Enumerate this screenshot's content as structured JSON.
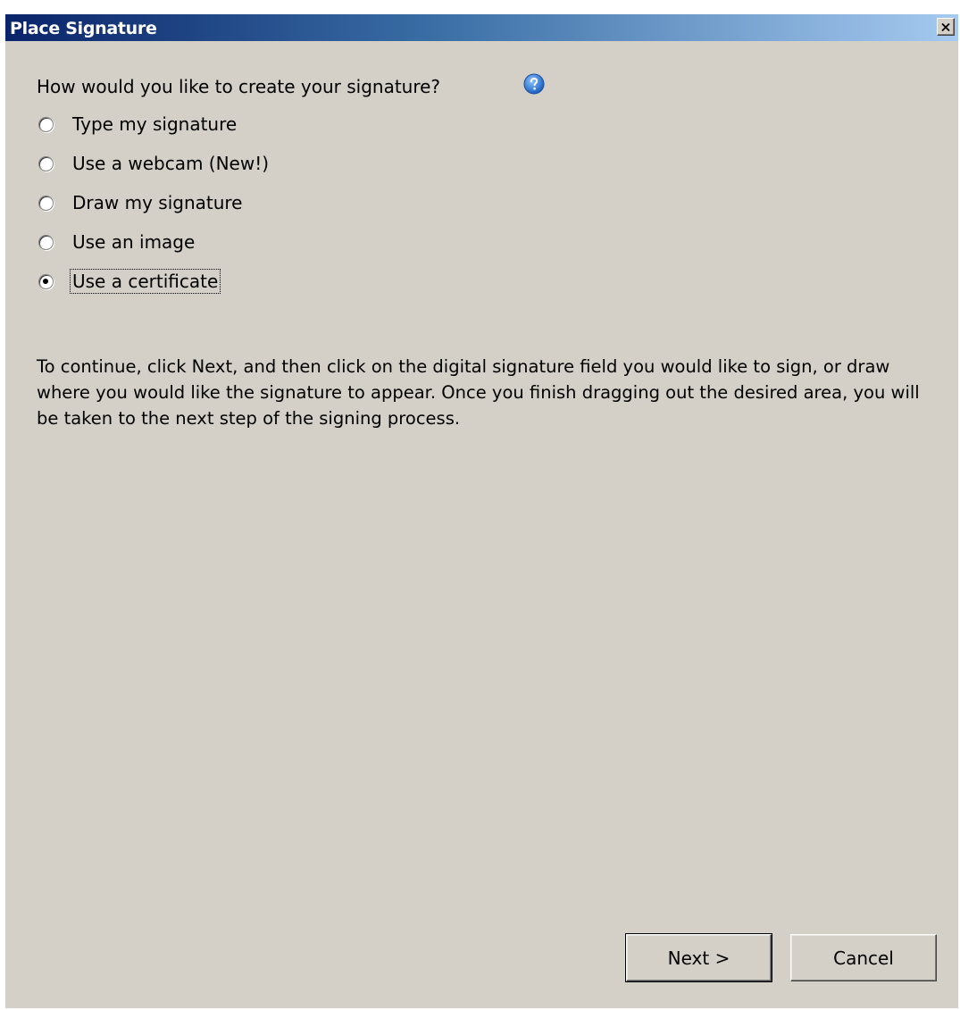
{
  "window": {
    "title": "Place Signature",
    "close_icon": "close-icon"
  },
  "prompt": {
    "question": "How would you like to create your signature?",
    "help_icon": "help-icon"
  },
  "options": [
    {
      "label": "Type my signature",
      "selected": false
    },
    {
      "label": "Use a webcam (New!)",
      "selected": false
    },
    {
      "label": "Draw my signature",
      "selected": false
    },
    {
      "label": "Use an image",
      "selected": false
    },
    {
      "label": "Use a certificate",
      "selected": true
    }
  ],
  "instructions": "To continue, click Next, and then click on the digital signature field you would like to sign, or draw where you would like the signature to appear. Once you finish dragging out the desired area, you will be taken to the next step of the signing process.",
  "buttons": {
    "next_label": "Next >",
    "cancel_label": "Cancel"
  },
  "colors": {
    "dialog_background": "#d4d0c8",
    "titlebar_start": "#0a246a",
    "titlebar_end": "#a6caf0",
    "help_icon_blue": "#2f7fd8"
  }
}
